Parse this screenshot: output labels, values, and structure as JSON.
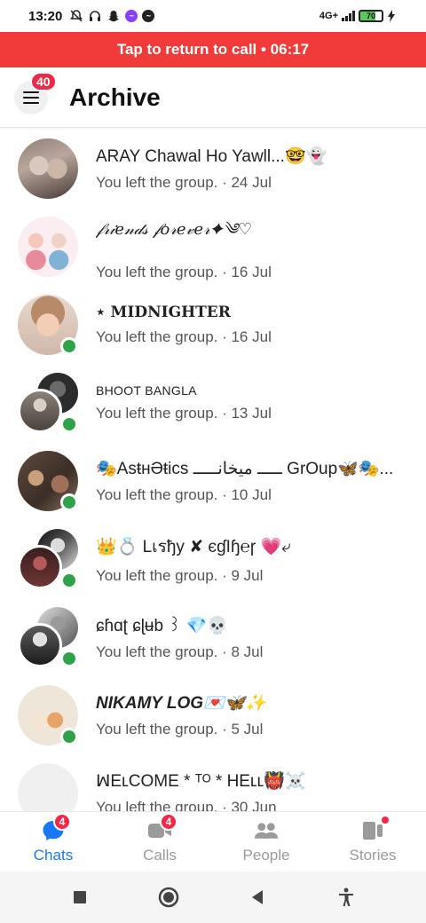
{
  "status_bar": {
    "time": "13:20",
    "network": "4G+",
    "battery": "70"
  },
  "call_banner": {
    "text": "Tap to return to call • 06:17"
  },
  "header": {
    "menu_badge": "40",
    "title": "Archive"
  },
  "chats": [
    {
      "name": "ARAY Chawal Ho Yawll...🤓👻",
      "preview": "You left the group. · 24 Jul",
      "online": false
    },
    {
      "name": "𝒻𝓇𝒾𝑒𝓃𝒹𝓈 𝒻𝑜𝓇𝑒𝓋𝑒𝓇✦༄♡",
      "preview": "You left the group. · 16 Jul",
      "online": false
    },
    {
      "name": "⋆ MIDNIGHTER",
      "preview": "You left the group. · 16 Jul",
      "online": true
    },
    {
      "name": "BHOOT BANGLA",
      "preview": "You left the group. · 13 Jul",
      "online": true
    },
    {
      "name": "🎭AsŧнƏŧics ـــــ میخانـــــ GrOup🦋🎭...",
      "preview": "You left the group. · 10 Jul",
      "online": true
    },
    {
      "name": "👑💍 Lเรђy ✘ єɠӀɧ℮ɼ 💗⤶",
      "preview": "You left the group. · 9 Jul",
      "online": true
    },
    {
      "name": "ɕɦɑʈ ɕɭʉb ꒱ 💎💀",
      "preview": "You left the group. · 8 Jul",
      "online": true
    },
    {
      "name": "NIKAMY LOG💌🦋✨",
      "preview": "You left the group. · 5 Jul",
      "online": true
    },
    {
      "name": "ꟽΕʟϹΟΜΕ * ᵀᴼ * ΗΕʟʟ👹☠️",
      "preview": "You left the group. · 30 Jun",
      "online": false
    }
  ],
  "bottom_nav": [
    {
      "label": "Chats",
      "badge": "4",
      "active": true
    },
    {
      "label": "Calls",
      "badge": "4",
      "active": false
    },
    {
      "label": "People",
      "badge": "",
      "active": false
    },
    {
      "label": "Stories",
      "badge": "",
      "active": false
    }
  ],
  "colors": {
    "accent": "#1877f2",
    "call_banner": "#f13a3a",
    "badge": "#f02849",
    "online": "#31a24c"
  }
}
